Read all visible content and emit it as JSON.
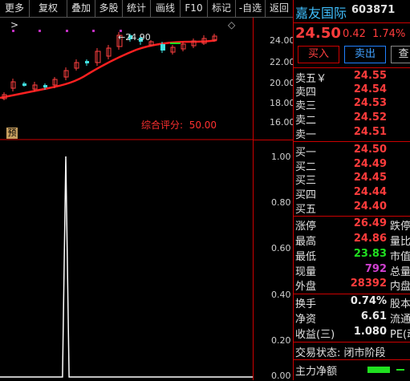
{
  "toolbar": {
    "items": [
      "更多 >",
      "复权",
      "叠加",
      "多股",
      "统计",
      "画线",
      "F10",
      "标记",
      "-自选",
      "返回"
    ]
  },
  "chart": {
    "price_label": "24.90",
    "score_label": "综合评分:",
    "score_value": "50.00",
    "pre_marker": "预",
    "price_axis": [
      "24.00",
      "22.00",
      "20.00",
      "18.00",
      "16.00"
    ],
    "ind_axis": [
      "1.00",
      "0.80",
      "0.60",
      "0.40",
      "0.20",
      "0.00"
    ],
    "diamond": "◇"
  },
  "chart_data": {
    "type": "line",
    "title": "",
    "main_axis_ylim": [
      14.5,
      25.5
    ],
    "indicator_axis_ylim": [
      0,
      1.05
    ],
    "indicator_values": [
      0,
      0,
      0,
      0,
      0,
      0,
      0,
      0,
      0,
      0,
      0,
      0,
      0,
      0,
      0,
      0,
      0,
      0,
      0,
      0,
      1.0,
      0,
      0,
      0,
      0,
      0,
      0,
      0,
      0,
      0,
      0,
      0,
      0,
      0,
      0,
      0,
      0,
      0,
      0,
      0,
      0,
      0,
      0,
      0,
      0,
      0,
      0,
      0,
      0,
      0,
      0,
      0,
      0,
      0,
      0,
      0,
      0,
      0,
      0,
      0,
      0,
      0,
      0,
      0,
      0,
      0,
      0,
      0,
      0,
      0,
      0,
      0,
      0,
      0,
      0,
      0,
      0,
      0
    ]
  },
  "quote": {
    "name": "嘉友国际",
    "code": "603871",
    "price": "24.50",
    "change": "0.42",
    "change_pct": "1.74%",
    "buy_btn": "买入",
    "sell_btn": "卖出",
    "more_btn": "查",
    "asks": [
      {
        "label": "卖五￥",
        "price": "24.55"
      },
      {
        "label": "卖四",
        "price": "24.54"
      },
      {
        "label": "卖三",
        "price": "24.53"
      },
      {
        "label": "卖二",
        "price": "24.52"
      },
      {
        "label": "卖一",
        "price": "24.51"
      }
    ],
    "bids": [
      {
        "label": "买一",
        "price": "24.50"
      },
      {
        "label": "买二",
        "price": "24.49"
      },
      {
        "label": "买三",
        "price": "24.45"
      },
      {
        "label": "买四",
        "price": "24.44"
      },
      {
        "label": "买五",
        "price": "24.40"
      }
    ],
    "stats": [
      {
        "label": "涨停",
        "value": "26.49",
        "label2": "跌停"
      },
      {
        "label": "最高",
        "value": "24.86",
        "label2": "量比"
      },
      {
        "label": "最低",
        "value": "23.83",
        "label2": "市值"
      },
      {
        "label": "现量",
        "value": "792",
        "label2": "总量"
      },
      {
        "label": "外盘",
        "value": "28392",
        "label2": "内盘"
      }
    ],
    "stats2": [
      {
        "label": "换手",
        "value": "0.74%",
        "label2": "股本"
      },
      {
        "label": "净资",
        "value": "6.61",
        "label2": "流通"
      },
      {
        "label": "收益(三)",
        "value": "1.080",
        "label2": "PE(动"
      }
    ],
    "status": "交易状态: 闭市阶段",
    "net_flow": "主力净额"
  }
}
